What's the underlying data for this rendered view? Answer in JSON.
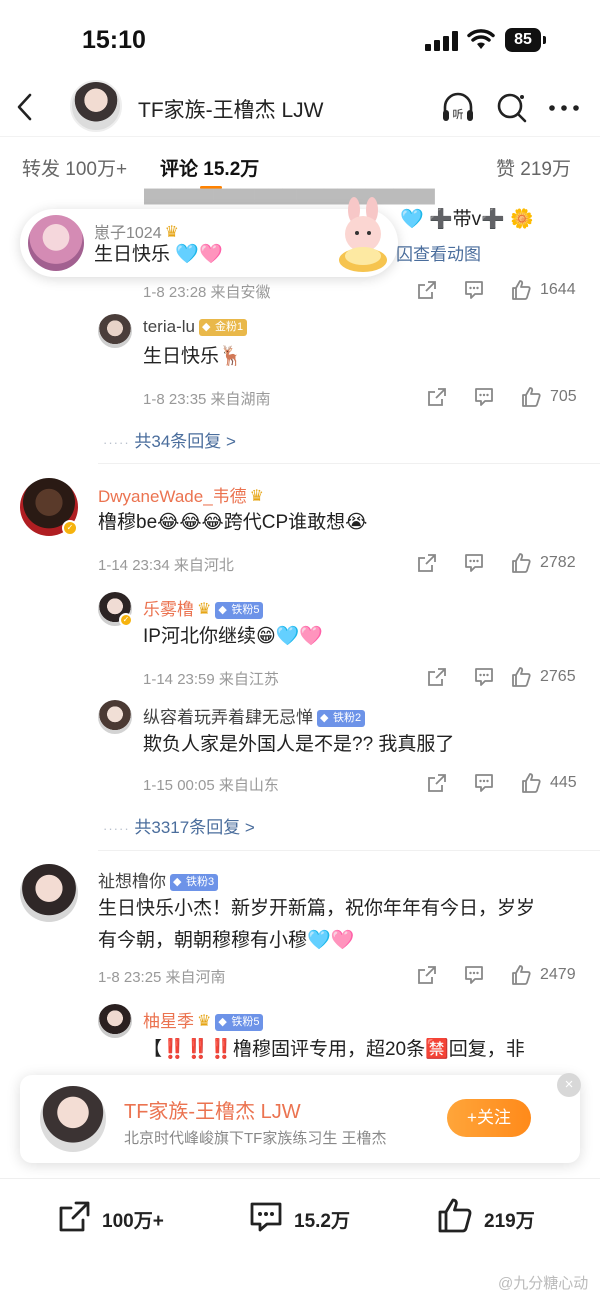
{
  "status_bar": {
    "time": "15:10",
    "battery": "85"
  },
  "header": {
    "title": "TF家族-王橹杰 LJW"
  },
  "tabs": {
    "repost": "转发 100万+",
    "comments": "评论 15.2万",
    "likes": "赞 219万"
  },
  "toast": {
    "name": "崽子1024",
    "text": "生日快乐"
  },
  "partial_top": {
    "line2": "囚查看动图",
    "emoji_text": "➕带v➕"
  },
  "comments": [
    {
      "meta": "1-8 23:28  来自安徽",
      "likes": "1644",
      "replies": [
        {
          "name": "teria-lu",
          "badge": "金粉1",
          "text": "生日快乐🦌",
          "meta": "1-8 23:35  来自湖南",
          "likes": "705"
        }
      ],
      "more": "共34条回复 >"
    },
    {
      "name": "DwyaneWade_韦德",
      "text": "橹穆be😂😂😂跨代CP谁敢想😭",
      "meta": "1-14 23:34  来自河北",
      "likes": "2782",
      "replies": [
        {
          "name": "乐雾橹",
          "badge": "铁粉5",
          "text": "IP河北你继续😁🩵🩷",
          "meta": "1-14 23:59  来自江苏",
          "likes": "2765"
        },
        {
          "name": "纵容着玩弄着肆无忌惮",
          "badge": "铁粉2",
          "text": "欺负人家是外国人是不是?? 我真服了",
          "meta": "1-15 00:05  来自山东",
          "likes": "445"
        }
      ],
      "more": "共3317条回复 >"
    },
    {
      "name": "祉想橹你",
      "badge": "铁粉3",
      "text_line1": "生日快乐小杰！新岁开新篇，祝你年年有今日，岁岁",
      "text_line2": "有今朝，朝朝穆穆有小穆🩵🩷",
      "meta": "1-8 23:25  来自河南",
      "likes": "2479",
      "replies": [
        {
          "name": "柚星季",
          "badge": "铁粉5",
          "text": "【‼️‼️‼️橹穆固评专用，超20条🈲回复，非"
        }
      ]
    }
  ],
  "follow_card": {
    "name": "TF家族-王橹杰 LJW",
    "desc": "北京时代峰峻旗下TF家族练习生 王橹杰",
    "button": "+关注",
    "close": "×"
  },
  "bottom_bar": {
    "share": "100万+",
    "comment": "15.2万",
    "like": "219万"
  },
  "watermark": "@九分糖心动"
}
